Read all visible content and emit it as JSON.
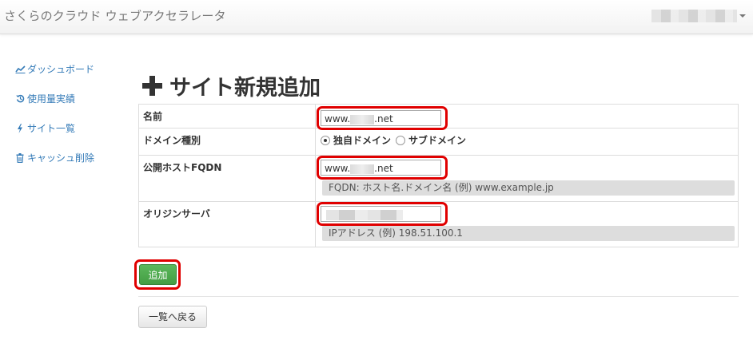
{
  "header": {
    "brand": "さくらのクラウド ウェブアクセラレータ"
  },
  "sidebar": {
    "items": [
      {
        "icon": "line-chart-icon",
        "label": "ダッシュボード"
      },
      {
        "icon": "history-icon",
        "label": "使用量実績"
      },
      {
        "icon": "bolt-icon",
        "label": "サイト一覧"
      },
      {
        "icon": "trash-icon",
        "label": "キャッシュ削除"
      }
    ]
  },
  "page": {
    "title": "サイト新規追加"
  },
  "form": {
    "name": {
      "label": "名前",
      "value_prefix": "www.",
      "value_suffix": ".net"
    },
    "domain_type": {
      "label": "ドメイン種別",
      "options": [
        {
          "label": "独自ドメイン",
          "checked": true
        },
        {
          "label": "サブドメイン",
          "checked": false
        }
      ]
    },
    "fqdn": {
      "label": "公開ホストFQDN",
      "value_prefix": "www.",
      "value_suffix": ".net",
      "help": "FQDN: ホスト名.ドメイン名 (例) www.example.jp"
    },
    "origin": {
      "label": "オリジンサーバ",
      "help": "IPアドレス (例) 198.51.100.1"
    }
  },
  "actions": {
    "add_label": "追加",
    "back_label": "一覧へ戻る"
  },
  "colors": {
    "highlight": "#e00000",
    "primary_button": "#449d44",
    "link": "#337ab7"
  }
}
